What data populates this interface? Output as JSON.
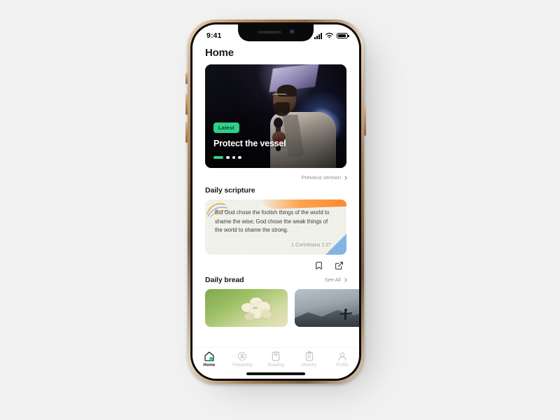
{
  "device": {
    "status_bar": {
      "time": "9:41",
      "signal_icon": "cellular-bars-icon",
      "wifi_icon": "wifi-icon",
      "battery_icon": "battery-icon"
    }
  },
  "app": {
    "page_title": "Home",
    "hero": {
      "badge": "Latest",
      "title": "Protect the vessel",
      "dots_total": 4,
      "dots_active_index": 0,
      "previous_link": "Previous sermon"
    },
    "scripture": {
      "section_title": "Daily scripture",
      "verse": "But God chose the foolish things of the world to shame the wise; God chose the weak things of the world to shame the strong.",
      "reference": "1 Corinthians 1:27",
      "actions": [
        {
          "name": "bookmark-icon",
          "label": "Bookmark"
        },
        {
          "name": "share-icon",
          "label": "Share"
        }
      ]
    },
    "bread": {
      "section_title": "Daily bread",
      "see_all": "See All",
      "cards": [
        {
          "name": "bread-card-flower",
          "alt": "White flower on green field"
        },
        {
          "name": "bread-card-mountain",
          "alt": "Person with arms outstretched on mountain"
        }
      ]
    },
    "tabs": [
      {
        "label": "Home",
        "icon": "home-icon",
        "active": true
      },
      {
        "label": "Fellowship",
        "icon": "fellowship-icon",
        "active": false
      },
      {
        "label": "Reading",
        "icon": "book-icon",
        "active": false
      },
      {
        "label": "Ministry",
        "icon": "clipboard-icon",
        "active": false
      },
      {
        "label": "Profile",
        "icon": "person-icon",
        "active": false
      }
    ]
  },
  "colors": {
    "accent_green": "#2fcf8a",
    "scripture_bg": "#f4f4ee",
    "scripture_orange": "#ff8c28",
    "scripture_blue": "#78b4eb",
    "text_primary": "#1a1a1a",
    "text_muted": "#8d8d92",
    "scene_bg": "#f2f2f2"
  }
}
